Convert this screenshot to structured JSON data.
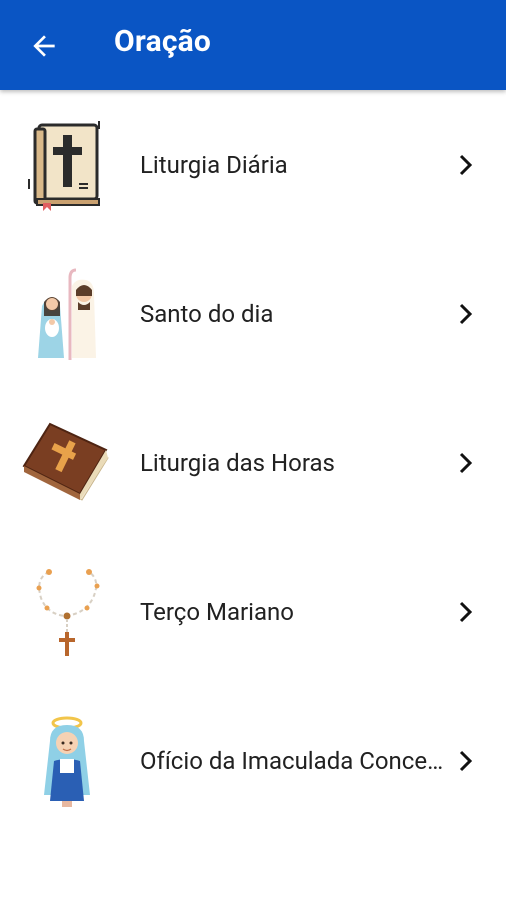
{
  "appbar": {
    "title": "Oração",
    "color": "#0a55c4",
    "back_icon": "arrow-left-icon"
  },
  "items": [
    {
      "label": "Liturgia Diária",
      "icon": "bible-cross-icon"
    },
    {
      "label": "Santo do dia",
      "icon": "holy-couple-icon"
    },
    {
      "label": "Liturgia das Horas",
      "icon": "prayer-book-icon"
    },
    {
      "label": "Terço Mariano",
      "icon": "rosary-icon"
    },
    {
      "label": "Ofício da Imaculada Conceição",
      "icon": "virgin-mary-icon"
    }
  ]
}
